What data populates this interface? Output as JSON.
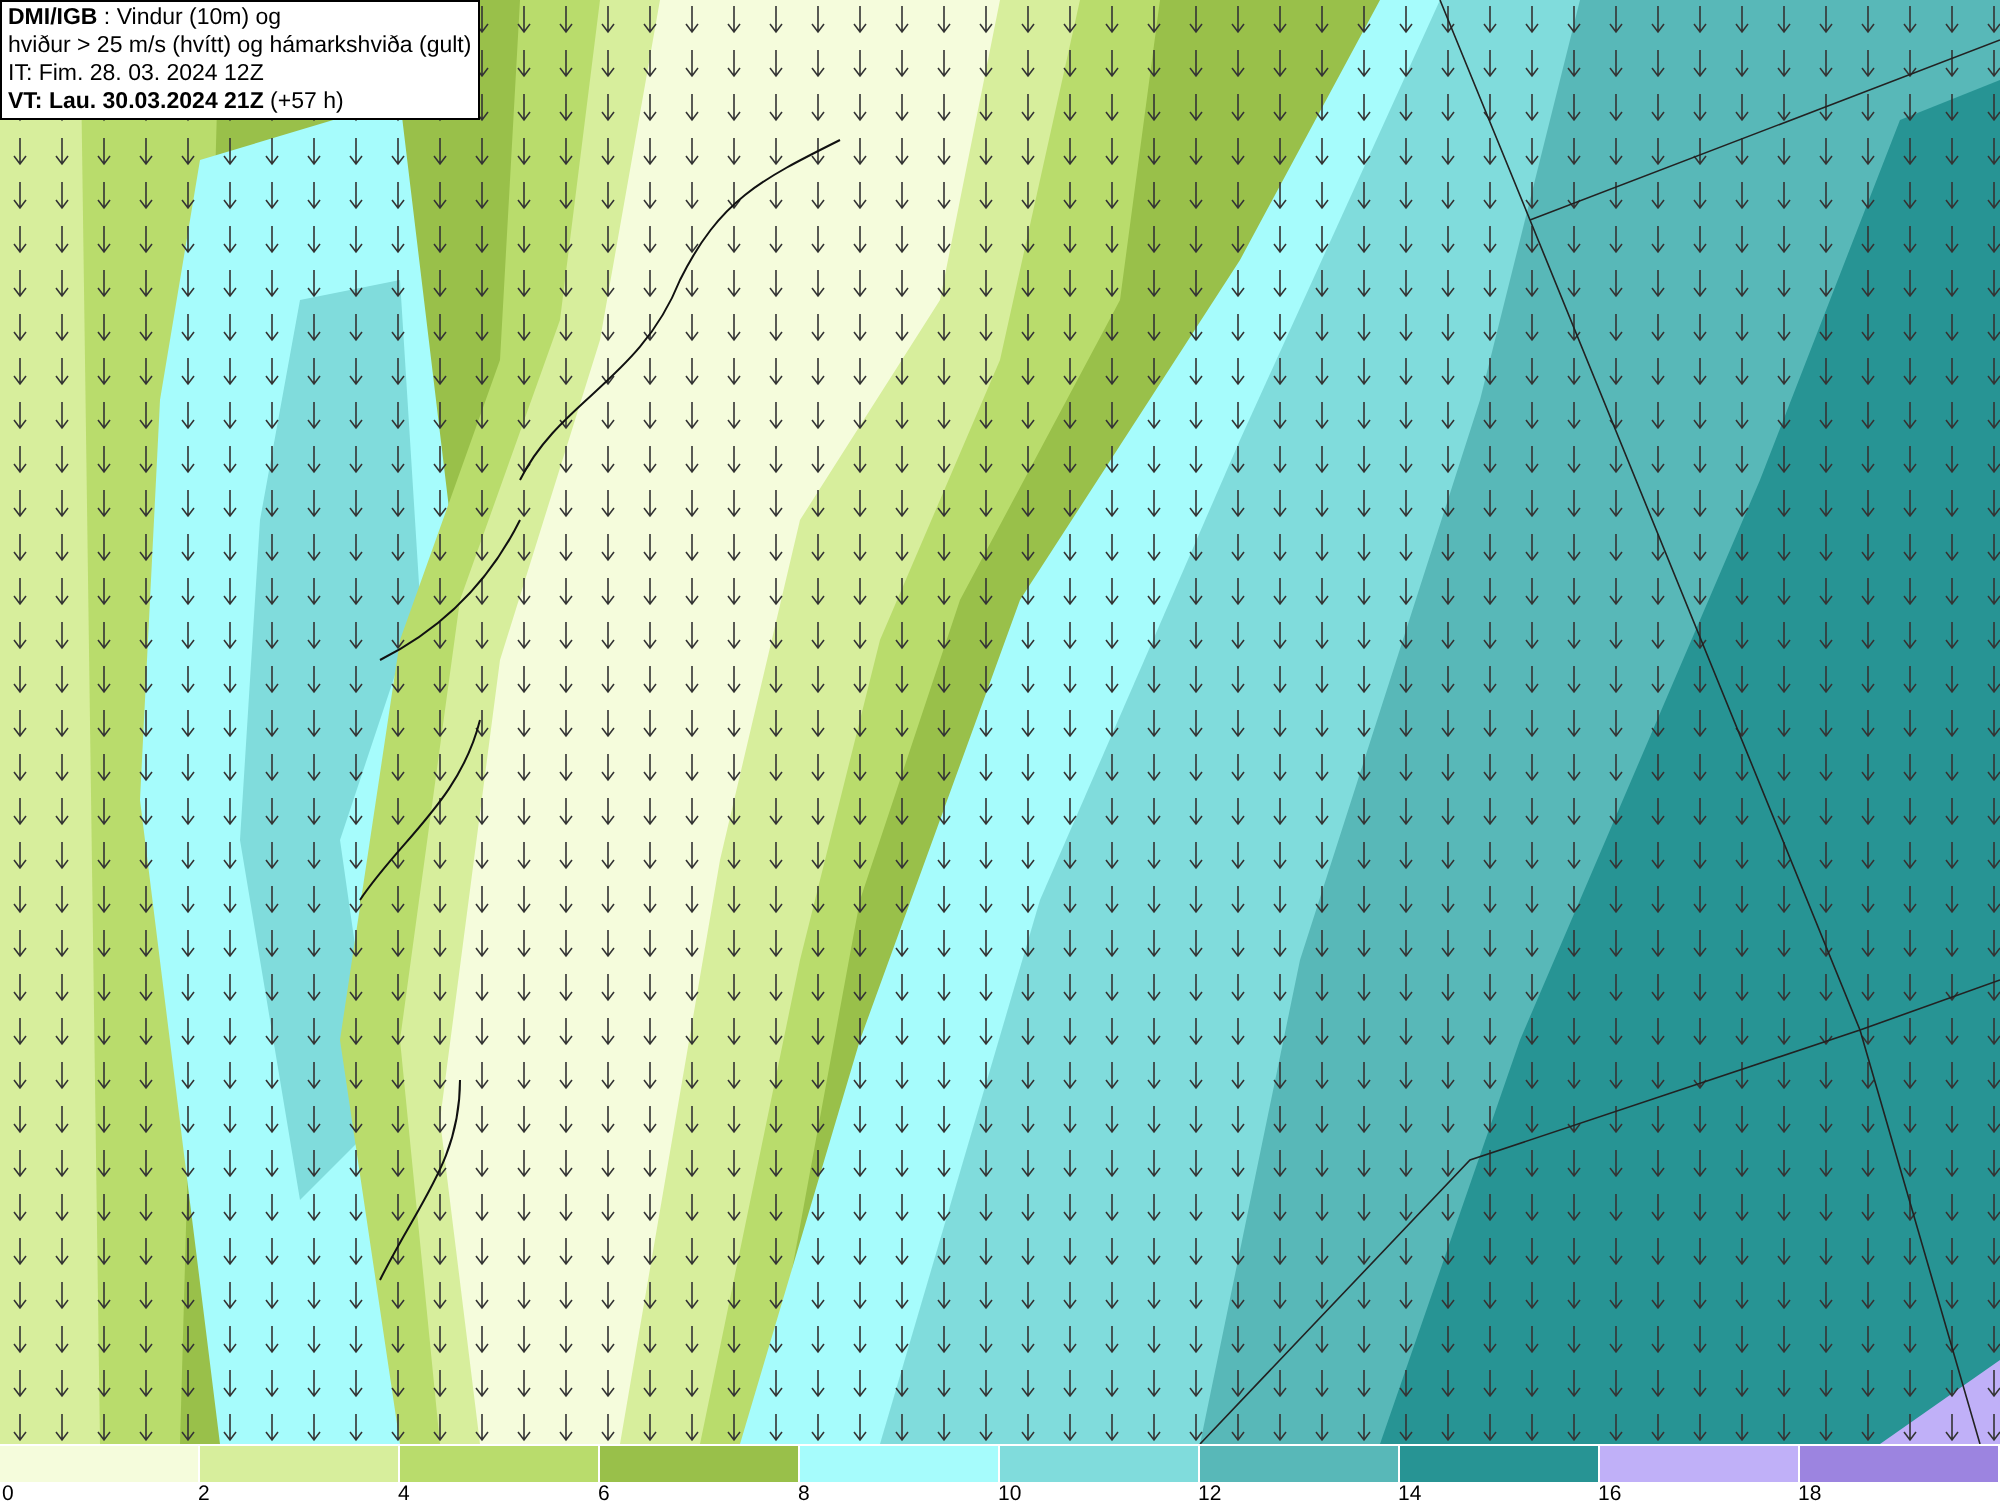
{
  "info_box": {
    "lines": [
      "**DMI/IGB** : Vindur (10m) og",
      "hviður > 25 m/s (hvítt) og hámarkshviða (gult)",
      "IT: Fim. 28. 03. 2024 12Z",
      "**VT: Lau. 30.03.2024 21Z** (+57 h)"
    ]
  },
  "legend": {
    "bins": [
      {
        "label": "0",
        "color": "#f5fcdc"
      },
      {
        "label": "2",
        "color": "#d7ee9c"
      },
      {
        "label": "4",
        "color": "#b9dc6c"
      },
      {
        "label": "6",
        "color": "#99c04a"
      },
      {
        "label": "8",
        "color": "#a6fcfc"
      },
      {
        "label": "10",
        "color": "#80dcdc"
      },
      {
        "label": "12",
        "color": "#58b8b8"
      },
      {
        "label": "14",
        "color": "#279494"
      },
      {
        "label": "16",
        "color": "#c0b0f8"
      },
      {
        "label": "18",
        "color": "#9c84e0"
      }
    ]
  }
}
